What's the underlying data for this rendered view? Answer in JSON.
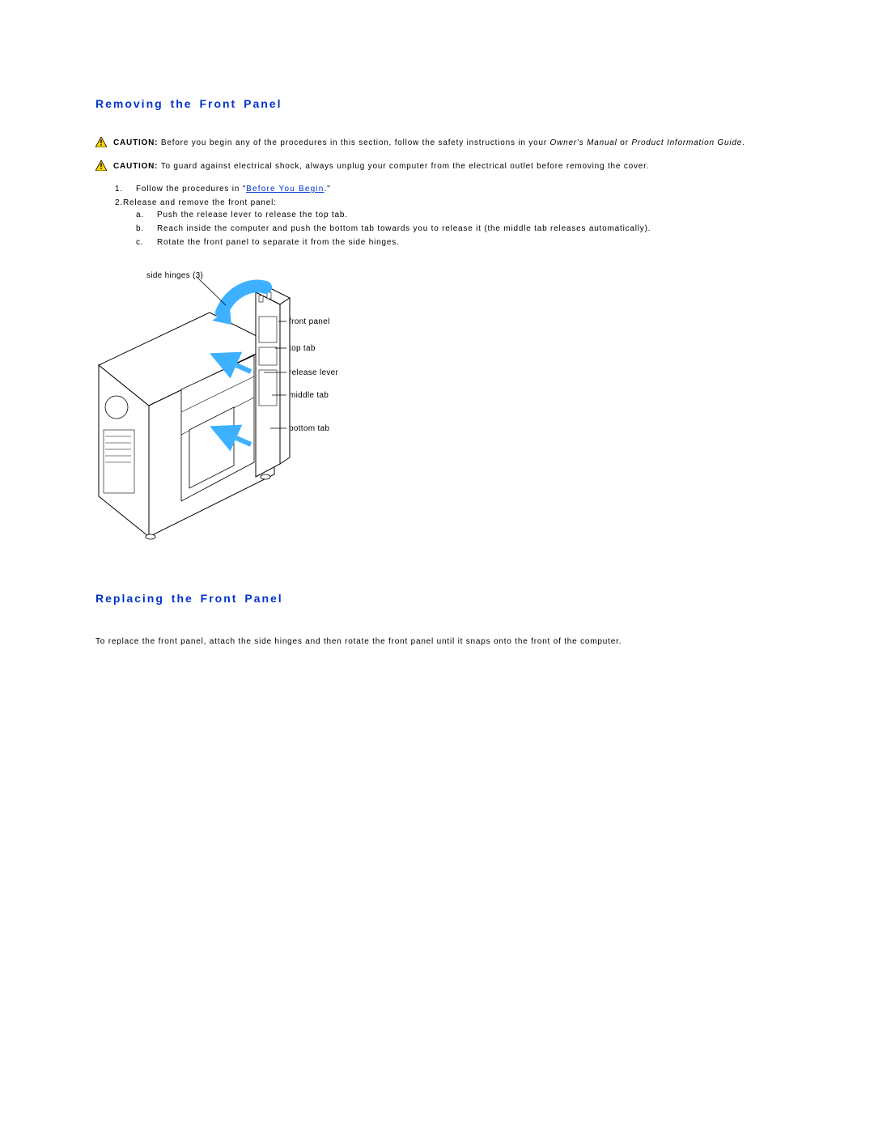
{
  "sections": {
    "removing": {
      "heading": "Removing the Front Panel",
      "cautions": [
        {
          "label": "CAUTION:",
          "text_before": " Before you begin any of the procedures in this section, follow the safety instructions in your ",
          "italic1": "Owner's Manual",
          "text_mid": " or ",
          "italic2": "Product Information Guide",
          "text_after": "."
        },
        {
          "label": "CAUTION:",
          "text": " To guard against electrical shock, always unplug your computer from the electrical outlet before removing the cover."
        }
      ],
      "steps": [
        {
          "num": "1.",
          "pre": "Follow the procedures in \"",
          "link": "Before You Begin",
          "post": ".\""
        },
        {
          "num": "2.",
          "text": "Release and remove the front panel:",
          "sub": [
            {
              "let": "a.",
              "text": "Push the release lever to release the top tab."
            },
            {
              "let": "b.",
              "text": "Reach inside the computer and push the bottom tab towards you to release it (the middle tab releases automatically)."
            },
            {
              "let": "c.",
              "text": "Rotate the front panel to separate it from the side hinges."
            }
          ]
        }
      ],
      "figure_labels": {
        "side": "side hinges (3)",
        "front": "front panel",
        "top": "top tab",
        "rel": "release lever",
        "mid": "middle tab",
        "bot": "bottom tab"
      }
    },
    "replacing": {
      "heading": "Replacing the Front Panel",
      "body": "To replace the front panel, attach the side hinges and then rotate the front panel until it snaps onto the front of the computer."
    }
  }
}
